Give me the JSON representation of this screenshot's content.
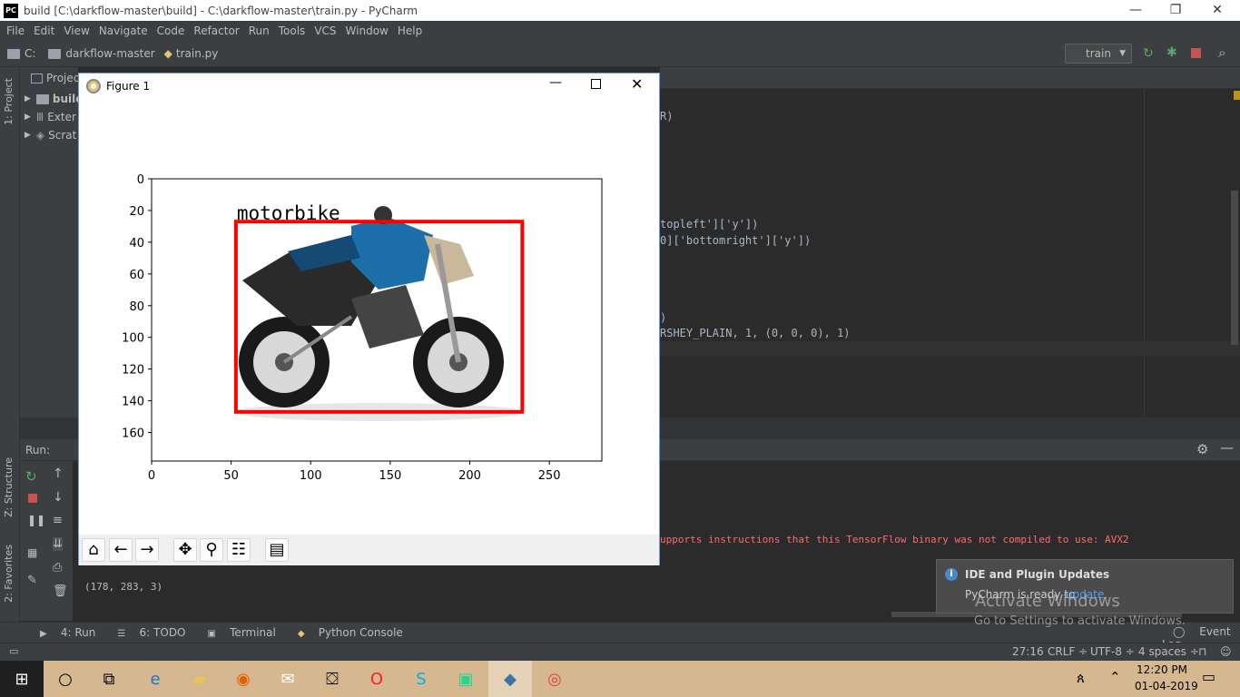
{
  "window": {
    "title": "build [C:\\darkflow-master\\build] - C:\\darkflow-master\\train.py - PyCharm",
    "min": "—",
    "max": "❐",
    "close": "✕"
  },
  "menu": [
    "File",
    "Edit",
    "View",
    "Navigate",
    "Code",
    "Refactor",
    "Run",
    "Tools",
    "VCS",
    "Window",
    "Help"
  ],
  "nav": {
    "drive": "C:",
    "folder": "darkflow-master",
    "file": "train.py",
    "run_config": "train"
  },
  "left_tabs": {
    "project": "1: Project",
    "structure": "Z: Structure",
    "favorites": "2: Favorites"
  },
  "project": {
    "header": "Projec",
    "items": [
      "build",
      "Exter",
      "Scrat"
    ]
  },
  "editor_lines": [
    {
      "text": "R)"
    },
    {
      "text": "topleft']['y'])"
    },
    {
      "text": "0]['bottomright']['y'])"
    },
    {
      "text": ")"
    },
    {
      "text": "RSHEY_PLAIN, 1, (0, 0, 0), 1)"
    }
  ],
  "run": {
    "label": "Run:",
    "warning": "upports instructions that this TensorFlow binary was not compiled to use: AVX2",
    "output": "(178, 283, 3)"
  },
  "bottom_tabs": [
    "4: Run",
    "6: TODO",
    "Terminal",
    "Python Console"
  ],
  "event_log": "Event Log",
  "status": {
    "position": "27:16",
    "line_sep": "CRLF ÷",
    "encoding": "UTF-8 ÷",
    "indent": "4 spaces ÷"
  },
  "notification": {
    "title": "IDE and Plugin Updates",
    "body": "PyCharm is ready to",
    "link": "update."
  },
  "activate": {
    "line1": "Activate Windows",
    "line2": "Go to Settings to activate Windows."
  },
  "figure": {
    "title": "Figure 1",
    "label": "motorbike",
    "box": {
      "x1": 53,
      "y1": 27,
      "x2": 233,
      "y2": 147
    },
    "chart_data": {
      "type": "image",
      "xticks": [
        0,
        50,
        100,
        150,
        200,
        250
      ],
      "yticks": [
        0,
        20,
        40,
        60,
        80,
        100,
        120,
        140,
        160
      ],
      "xlim": [
        0,
        283
      ],
      "ylim": [
        178,
        0
      ]
    }
  },
  "taskbar": {
    "time": "12:20 PM",
    "date": "01-04-2019"
  },
  "colors": {
    "box": "#ff0000",
    "accent": "#4a88c7",
    "warning": "#ff6b68"
  }
}
